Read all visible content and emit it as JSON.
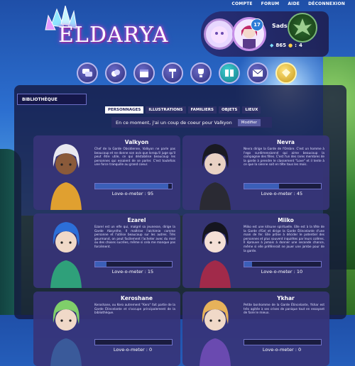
{
  "topnav": [
    "COMPTE",
    "FORUM",
    "AIDE",
    "DÉCONNEXION"
  ],
  "logo": {
    "text": "ELDARYA"
  },
  "profile": {
    "username": "Sads",
    "level": "17",
    "currency": "865",
    "diamonds": "4"
  },
  "navicons": [
    "chat-icon",
    "coins-icon",
    "calendar-icon",
    "hammer-icon",
    "trophy-icon",
    "library-icon",
    "mail-icon",
    "gem-icon"
  ],
  "panel": {
    "title": "BIBLIOTHÈQUE",
    "tabs": [
      "PERSONNAGES",
      "ILLUSTRATIONS",
      "FAMILIERS",
      "OBJETS",
      "LIEUX"
    ],
    "favorite_text": "En ce moment, j'ai un coup de coeur pour Valkyon",
    "modify_label": "Modifier"
  },
  "love_label": "Love-o-meter : ",
  "characters": [
    {
      "name": "Valkyon",
      "desc": "Chef de la Garde Obsidienne, Valkyon ne parle pas beaucoup et ne donne son avis que lorsqu'il juge qu'il peut être utile, ce qui déstabilise beaucoup les personnes qui essaient de se parler. C'est toutefois une force tranquille au grand coeur.",
      "love": 95,
      "hair": "#e8e8f0",
      "skin": "#8a5a3a",
      "cloth": "#e0a030"
    },
    {
      "name": "Nevra",
      "desc": "Nevra dirige la Garde de l'Ombre. C'est un homme à l'ego surdimensionné qui aime beaucoup la compagnie des filles. C'est l'un des rares membres de la garde à prendre le classement \"Love\" et il tente à ce que la sienne soit en tête tous les mois.",
      "love": 45,
      "hair": "#1a1a22",
      "skin": "#e9d2c4",
      "cloth": "#2a2a33"
    },
    {
      "name": "Ezarel",
      "desc": "Ezarel est un elfe qui, malgré sa jeunesse, dirige la Garde Absynthe. Il maîtrise l'alchimie comme personne et l'utilise beaucoup sur les autres. Très gourmand, on peut facilement l'acheter avec du miel ou des choses sucrées, même si cela me manque pas forcément.",
      "love": 15,
      "hair": "#2c6fd8",
      "skin": "#f0d9c8",
      "cloth": "#2fa07a"
    },
    {
      "name": "Miiko",
      "desc": "Miiko est une kitsune spirituelle. Elle est à la tête de la Garde d'Eel et dirige la Garde Étincelante d'une main de fer. Elle prône à décider le potentiel des personnes et plus souvent inquiètes par leurs colères. Il éprouve à jamais à donner une seconde chance, même si elle préférerait ne jouer une jambe pour de la garde.",
      "love": 10,
      "hair": "#15151f",
      "skin": "#f4e0d6",
      "cloth": "#a12a4a"
    },
    {
      "name": "Keroshane",
      "desc": "Keroshane, ou Kero autrement \"Kero\" fait partie de la Garde Étincelante et s'occupe principalement de la bibliothèque.",
      "love": 0,
      "hair": "#7fcf6a",
      "skin": "#f0d9c8",
      "cloth": "#3a5a9a"
    },
    {
      "name": "Ykhar",
      "desc": "Petite bonhomme de la Garde Étincelante, Ykhar est très agitée à ses crises de panique tout en essayant de faire le mieux.",
      "love": 0,
      "hair": "#e7b25a",
      "skin": "#f0d9c8",
      "cloth": "#6a4ab0"
    }
  ],
  "colors": {
    "panel": "#14163c",
    "accent": "#6d6fc6",
    "bar_fill": "#3b5fb8"
  }
}
